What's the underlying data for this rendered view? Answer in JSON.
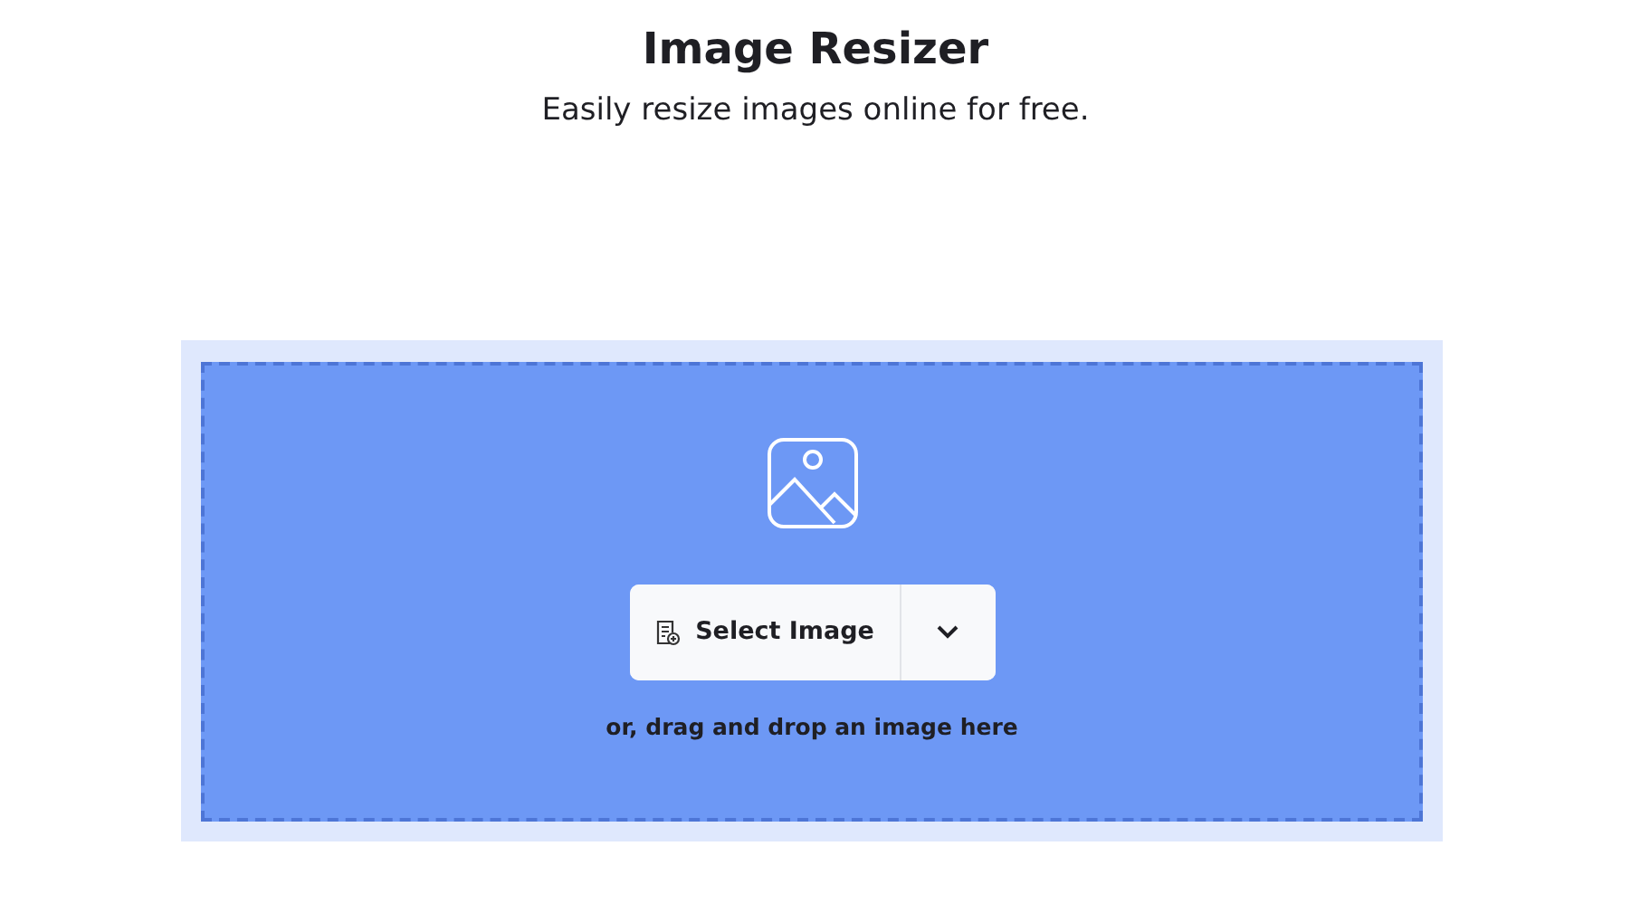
{
  "header": {
    "title": "Image Resizer",
    "subtitle": "Easily resize images online for free."
  },
  "dropzone": {
    "button": "Select Image",
    "hint": "or, drag and drop an image here"
  }
}
